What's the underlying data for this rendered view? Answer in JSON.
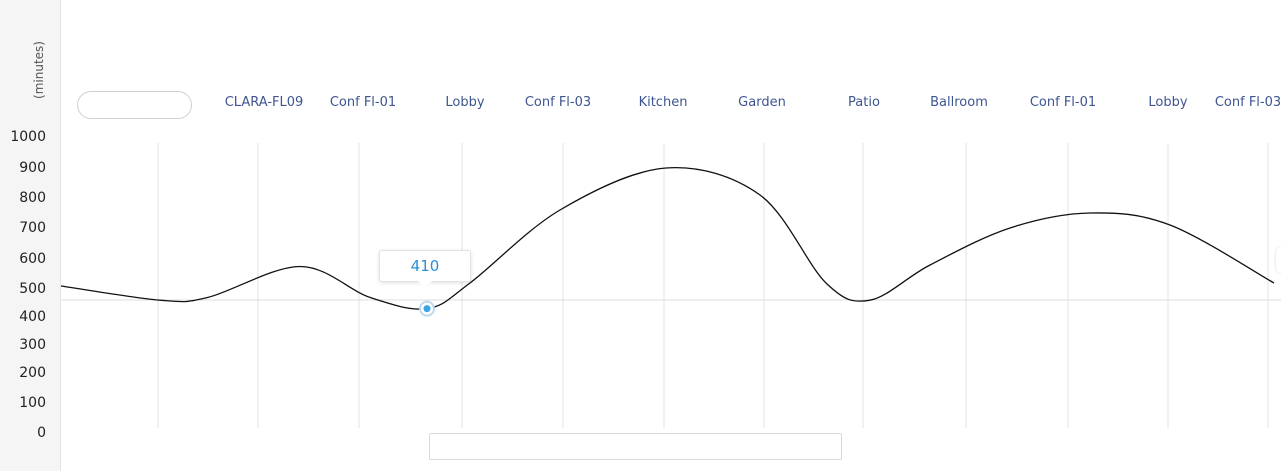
{
  "chart_data": {
    "type": "line",
    "y_unit_label": "(minutes)",
    "y_ticks": [
      "1000",
      "900",
      "800",
      "700",
      "600",
      "500",
      "400",
      "300",
      "200",
      "100",
      "0"
    ],
    "categories": [
      "CLARA-FL09",
      "Conf Fl-01",
      "Lobby",
      "Conf Fl-03",
      "Kitchen",
      "Garden",
      "Patio",
      "Ballroom",
      "Conf Fl-01",
      "Lobby",
      "Conf Fl-03"
    ],
    "ylim": [
      0,
      1000
    ],
    "series": [
      {
        "values": [
          510,
          460,
          470,
          575,
          470,
          430,
          520,
          760,
          900,
          810,
          520,
          460,
          580,
          700,
          750,
          710,
          520
        ]
      }
    ],
    "highlight": {
      "label": "410",
      "value": 410
    },
    "colors": {
      "line": "#111111",
      "grid": "#e3e3e3",
      "marker": "#39a4e6",
      "category_text": "#3e5590"
    }
  }
}
